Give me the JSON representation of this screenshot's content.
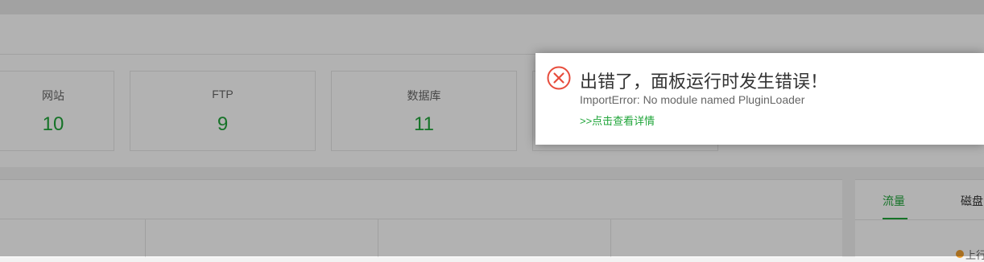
{
  "stats": [
    {
      "label": "网站",
      "value": "10"
    },
    {
      "label": "FTP",
      "value": "9"
    },
    {
      "label": "数据库",
      "value": "11"
    }
  ],
  "tabs": {
    "traffic": "流量",
    "disk": "磁盘"
  },
  "legend": {
    "upload_label": "上行"
  },
  "error": {
    "title": "出错了，面板运行时发生错误！",
    "message": "ImportError: No module named PluginLoader",
    "details_link": ">>点击查看详情"
  },
  "colors": {
    "accent_green": "#20a53a",
    "error_red": "#e74c3c",
    "legend_orange": "#f0a030"
  }
}
